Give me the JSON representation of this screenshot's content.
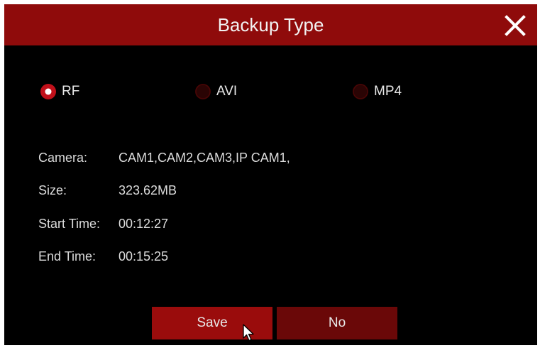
{
  "dialog": {
    "title": "Backup Type",
    "colors": {
      "titlebar": "#8f0b0b",
      "background": "#000000",
      "accent": "#c0101a"
    }
  },
  "format_options": {
    "selected": "RF",
    "items": [
      {
        "label": "RF",
        "selected": true
      },
      {
        "label": "AVI",
        "selected": false
      },
      {
        "label": "MP4",
        "selected": false
      }
    ]
  },
  "info": {
    "camera_label": "Camera:",
    "camera_value": "CAM1,CAM2,CAM3,IP CAM1,",
    "size_label": "Size:",
    "size_value": "323.62MB",
    "start_label": "Start Time:",
    "start_value": "00:12:27",
    "end_label": "End Time:",
    "end_value": "00:15:25"
  },
  "buttons": {
    "save_label": "Save",
    "no_label": "No"
  },
  "icons": {
    "close": "close-icon",
    "cursor": "mouse-pointer-icon"
  }
}
